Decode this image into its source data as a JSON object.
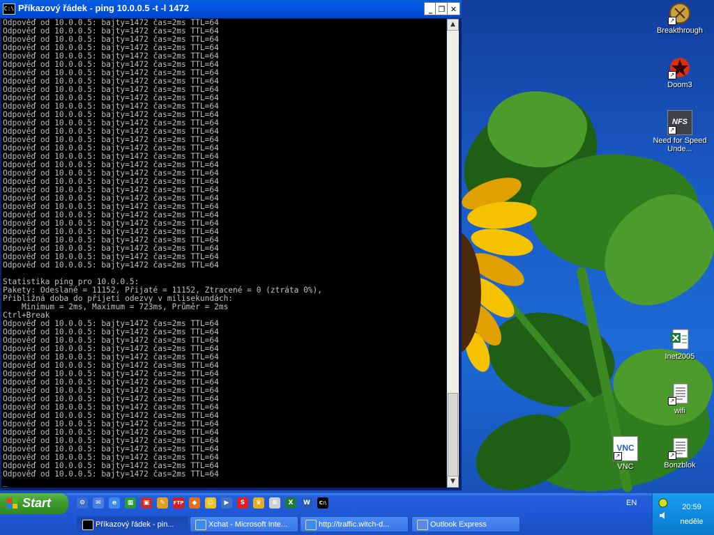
{
  "window": {
    "title": "Příkazový řádek - ping 10.0.0.5 -t -l 1472",
    "sys_icon_text": "C:\\",
    "btn_minimize": "_",
    "btn_restore": "❐",
    "btn_close": "✕"
  },
  "console": {
    "lines": [
      "Odpověď od 10.0.0.5: bajty=1472 čas=2ms TTL=64",
      "Odpověď od 10.0.0.5: bajty=1472 čas=2ms TTL=64",
      "Odpověď od 10.0.0.5: bajty=1472 čas=2ms TTL=64",
      "Odpověď od 10.0.0.5: bajty=1472 čas=2ms TTL=64",
      "Odpověď od 10.0.0.5: bajty=1472 čas=2ms TTL=64",
      "Odpověď od 10.0.0.5: bajty=1472 čas=2ms TTL=64",
      "Odpověď od 10.0.0.5: bajty=1472 čas=2ms TTL=64",
      "Odpověď od 10.0.0.5: bajty=1472 čas=2ms TTL=64",
      "Odpověď od 10.0.0.5: bajty=1472 čas=2ms TTL=64",
      "Odpověď od 10.0.0.5: bajty=1472 čas=2ms TTL=64",
      "Odpověď od 10.0.0.5: bajty=1472 čas=2ms TTL=64",
      "Odpověď od 10.0.0.5: bajty=1472 čas=2ms TTL=64",
      "Odpověď od 10.0.0.5: bajty=1472 čas=2ms TTL=64",
      "Odpověď od 10.0.0.5: bajty=1472 čas=2ms TTL=64",
      "Odpověď od 10.0.0.5: bajty=1472 čas=2ms TTL=64",
      "Odpověď od 10.0.0.5: bajty=1472 čas=2ms TTL=64",
      "Odpověď od 10.0.0.5: bajty=1472 čas=2ms TTL=64",
      "Odpověď od 10.0.0.5: bajty=1472 čas=2ms TTL=64",
      "Odpověď od 10.0.0.5: bajty=1472 čas=2ms TTL=64",
      "Odpověď od 10.0.0.5: bajty=1472 čas=2ms TTL=64",
      "Odpověď od 10.0.0.5: bajty=1472 čas=2ms TTL=64",
      "Odpověď od 10.0.0.5: bajty=1472 čas=2ms TTL=64",
      "Odpověď od 10.0.0.5: bajty=1472 čas=2ms TTL=64",
      "Odpověď od 10.0.0.5: bajty=1472 čas=2ms TTL=64",
      "Odpověď od 10.0.0.5: bajty=1472 čas=2ms TTL=64",
      "Odpověď od 10.0.0.5: bajty=1472 čas=2ms TTL=64",
      "Odpověď od 10.0.0.5: bajty=1472 čas=3ms TTL=64",
      "Odpověď od 10.0.0.5: bajty=1472 čas=2ms TTL=64",
      "Odpověď od 10.0.0.5: bajty=1472 čas=2ms TTL=64",
      "Odpověď od 10.0.0.5: bajty=1472 čas=2ms TTL=64",
      "",
      "Statistika ping pro 10.0.0.5:",
      "Pakety: Odeslané = 11152, Přijaté = 11152, Ztracené = 0 (ztráta 0%),",
      "Přibližná doba do přijetí odezvy v milisekundách:",
      "    Minimum = 2ms, Maximum = 723ms, Průměr = 2ms",
      "Ctrl+Break",
      "Odpověď od 10.0.0.5: bajty=1472 čas=2ms TTL=64",
      "Odpověď od 10.0.0.5: bajty=1472 čas=2ms TTL=64",
      "Odpověď od 10.0.0.5: bajty=1472 čas=2ms TTL=64",
      "Odpověď od 10.0.0.5: bajty=1472 čas=2ms TTL=64",
      "Odpověď od 10.0.0.5: bajty=1472 čas=2ms TTL=64",
      "Odpověď od 10.0.0.5: bajty=1472 čas=3ms TTL=64",
      "Odpověď od 10.0.0.5: bajty=1472 čas=2ms TTL=64",
      "Odpověď od 10.0.0.5: bajty=1472 čas=2ms TTL=64",
      "Odpověď od 10.0.0.5: bajty=1472 čas=2ms TTL=64",
      "Odpověď od 10.0.0.5: bajty=1472 čas=2ms TTL=64",
      "Odpověď od 10.0.0.5: bajty=1472 čas=2ms TTL=64",
      "Odpověď od 10.0.0.5: bajty=1472 čas=2ms TTL=64",
      "Odpověď od 10.0.0.5: bajty=1472 čas=2ms TTL=64",
      "Odpověď od 10.0.0.5: bajty=1472 čas=2ms TTL=64",
      "Odpověď od 10.0.0.5: bajty=1472 čas=2ms TTL=64",
      "Odpověď od 10.0.0.5: bajty=1472 čas=2ms TTL=64",
      "Odpověď od 10.0.0.5: bajty=1472 čas=2ms TTL=64",
      "Odpověď od 10.0.0.5: bajty=1472 čas=2ms TTL=64",
      "Odpověď od 10.0.0.5: bajty=1472 čas=2ms TTL=64",
      "_"
    ]
  },
  "desktop_icons": [
    {
      "label": "Breakthrough",
      "icon": "breakthrough-icon",
      "color": "#c8a040"
    },
    {
      "label": "Doom3",
      "icon": "doom3-icon",
      "color": "#d83010"
    },
    {
      "label": "Need for Speed Unde...",
      "icon": "nfs-icon",
      "color": "#404048"
    },
    {
      "label": "Inet2005",
      "icon": "excel-file-icon",
      "color": "#1e7a3a"
    },
    {
      "label": "wifi",
      "icon": "text-file-icon",
      "color": "#f0f0f0"
    },
    {
      "label": "VNC",
      "icon": "vnc-icon",
      "color": "#2060c0"
    },
    {
      "label": "Bonzblok",
      "icon": "text-file-icon",
      "color": "#f0f0f0"
    }
  ],
  "icon_texts": {
    "nfs": "NFS",
    "vnc": "VNC",
    "shortcut_arrow": "↗"
  },
  "taskbar": {
    "start_label": "Start",
    "language": "EN",
    "clock_time": "20:59",
    "clock_day": "neděle",
    "quick_launch": [
      {
        "icon": "gear-app-icon",
        "color": "#3a6fd0",
        "glyph": "⚙"
      },
      {
        "icon": "outlook-icon",
        "color": "#4a7fe0",
        "glyph": "✉"
      },
      {
        "icon": "ie-icon",
        "color": "#3b8cf0",
        "glyph": "e"
      },
      {
        "icon": "desktop-icon",
        "color": "#2b9a3a",
        "glyph": "▦"
      },
      {
        "icon": "floppy-icon",
        "color": "#c03030",
        "glyph": "▣"
      },
      {
        "icon": "tool-icon",
        "color": "#e0a020",
        "glyph": "✎"
      },
      {
        "icon": "ftp-icon",
        "color": "#d02020",
        "glyph": "FTP"
      },
      {
        "icon": "game-icon",
        "color": "#e07020",
        "glyph": "◆"
      },
      {
        "icon": "smiley-icon",
        "color": "#f0c020",
        "glyph": "☺"
      },
      {
        "icon": "media-player-icon",
        "color": "#4070c0",
        "glyph": "▶"
      },
      {
        "icon": "skype-icon",
        "color": "#e02020",
        "glyph": "S"
      },
      {
        "icon": "crown-icon",
        "color": "#e0b020",
        "glyph": "♛"
      },
      {
        "icon": "notepad-icon",
        "color": "#d0d0d0",
        "glyph": "≡"
      },
      {
        "icon": "excel-icon",
        "color": "#1e7a3a",
        "glyph": "X"
      },
      {
        "icon": "word-icon",
        "color": "#2a5ab8",
        "glyph": "W"
      },
      {
        "icon": "cmd-icon",
        "color": "#000000",
        "glyph": "C:\\"
      }
    ],
    "buttons": [
      {
        "label": "Příkazový řádek - pin...",
        "icon": "cmd-icon",
        "active": true
      },
      {
        "label": "Xchat - Microsoft Inte...",
        "icon": "ie-icon",
        "active": false
      },
      {
        "label": "http://traffic.witch-d...",
        "icon": "ie-icon",
        "active": false
      },
      {
        "label": "Outlook Express",
        "icon": "outlook-icon",
        "active": false
      }
    ]
  },
  "colors": {
    "title_bar": "#0058e6",
    "console_bg": "#000000",
    "console_fg": "#c0c0c0",
    "taskbar": "#245edb",
    "start": "#3c9a2c",
    "tray": "#0f8ae0"
  }
}
